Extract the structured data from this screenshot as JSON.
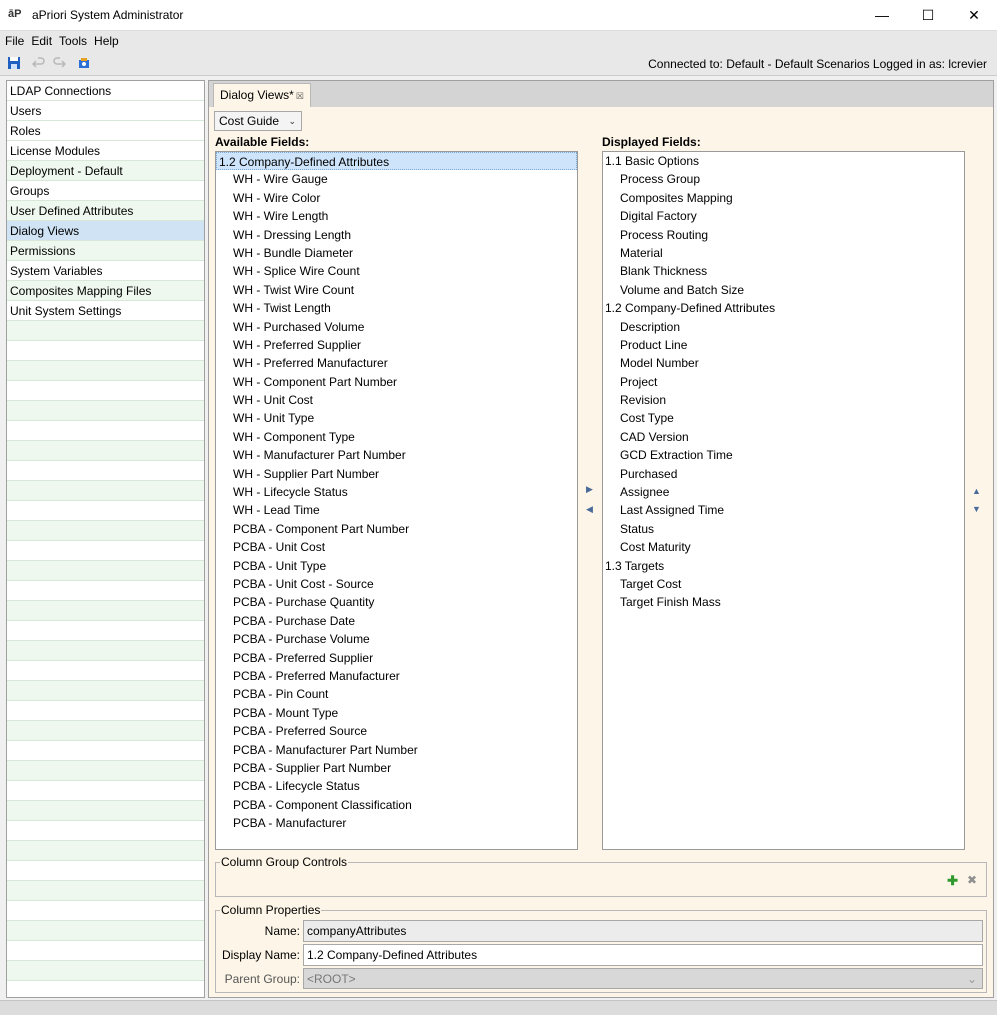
{
  "window": {
    "logo": "āP",
    "title": "aPriori System Administrator",
    "minimize": "—",
    "maximize": "☐",
    "close": "✕"
  },
  "menu": [
    "File",
    "Edit",
    "Tools",
    "Help"
  ],
  "toolbar": {
    "status": "Connected to: Default - Default Scenarios  Logged in as: lcrevier"
  },
  "sidebar": {
    "items": [
      {
        "label": "LDAP Connections"
      },
      {
        "label": "Users"
      },
      {
        "label": "Roles"
      },
      {
        "label": "License Modules"
      },
      {
        "label": "Deployment - Default"
      },
      {
        "label": "Groups"
      },
      {
        "label": "User Defined Attributes"
      },
      {
        "label": "Dialog Views",
        "selected": true
      },
      {
        "label": "Permissions"
      },
      {
        "label": "System Variables"
      },
      {
        "label": "Composites Mapping Files"
      },
      {
        "label": "Unit System Settings"
      }
    ]
  },
  "editor": {
    "tab_label": "Dialog Views*",
    "tab_close": "☒",
    "view_select": "Cost Guide",
    "available_label": "Available Fields:",
    "displayed_label": "Displayed Fields:",
    "available_fields": [
      {
        "label": "1.2 Company-Defined Attributes",
        "level": 0,
        "selected": true
      },
      {
        "label": "WH - Wire Gauge",
        "level": 1
      },
      {
        "label": "WH - Wire Color",
        "level": 1
      },
      {
        "label": "WH - Wire Length",
        "level": 1
      },
      {
        "label": "WH - Dressing Length",
        "level": 1
      },
      {
        "label": "WH - Bundle Diameter",
        "level": 1
      },
      {
        "label": "WH - Splice Wire Count",
        "level": 1
      },
      {
        "label": "WH - Twist Wire Count",
        "level": 1
      },
      {
        "label": "WH - Twist Length",
        "level": 1
      },
      {
        "label": "WH - Purchased Volume",
        "level": 1
      },
      {
        "label": "WH - Preferred Supplier",
        "level": 1
      },
      {
        "label": "WH - Preferred Manufacturer",
        "level": 1
      },
      {
        "label": "WH - Component Part Number",
        "level": 1
      },
      {
        "label": "WH - Unit Cost",
        "level": 1
      },
      {
        "label": "WH - Unit Type",
        "level": 1
      },
      {
        "label": "WH - Component Type",
        "level": 1
      },
      {
        "label": "WH - Manufacturer Part Number",
        "level": 1
      },
      {
        "label": "WH - Supplier Part Number",
        "level": 1
      },
      {
        "label": "WH - Lifecycle Status",
        "level": 1
      },
      {
        "label": "WH - Lead Time",
        "level": 1
      },
      {
        "label": "PCBA - Component Part Number",
        "level": 1
      },
      {
        "label": "PCBA - Unit Cost",
        "level": 1
      },
      {
        "label": "PCBA - Unit Type",
        "level": 1
      },
      {
        "label": "PCBA - Unit Cost - Source",
        "level": 1
      },
      {
        "label": "PCBA - Purchase Quantity",
        "level": 1
      },
      {
        "label": "PCBA - Purchase Date",
        "level": 1
      },
      {
        "label": "PCBA - Purchase Volume",
        "level": 1
      },
      {
        "label": "PCBA - Preferred Supplier",
        "level": 1
      },
      {
        "label": "PCBA - Preferred Manufacturer",
        "level": 1
      },
      {
        "label": "PCBA - Pin Count",
        "level": 1
      },
      {
        "label": "PCBA - Mount Type",
        "level": 1
      },
      {
        "label": "PCBA - Preferred Source",
        "level": 1
      },
      {
        "label": "PCBA - Manufacturer Part Number",
        "level": 1
      },
      {
        "label": "PCBA - Supplier Part Number",
        "level": 1
      },
      {
        "label": "PCBA - Lifecycle Status",
        "level": 1
      },
      {
        "label": "PCBA - Component Classification",
        "level": 1
      },
      {
        "label": "PCBA - Manufacturer",
        "level": 1
      }
    ],
    "displayed_fields": [
      {
        "label": "1.1 Basic Options",
        "level": 0
      },
      {
        "label": "Process Group",
        "level": 1
      },
      {
        "label": "Composites Mapping",
        "level": 1
      },
      {
        "label": "Digital Factory",
        "level": 1
      },
      {
        "label": "Process Routing",
        "level": 1
      },
      {
        "label": "Material",
        "level": 1
      },
      {
        "label": "Blank Thickness",
        "level": 1
      },
      {
        "label": "Volume and Batch Size",
        "level": 1
      },
      {
        "label": "1.2 Company-Defined Attributes",
        "level": 0
      },
      {
        "label": "Description",
        "level": 1
      },
      {
        "label": "Product Line",
        "level": 1
      },
      {
        "label": "Model Number",
        "level": 1
      },
      {
        "label": "Project",
        "level": 1
      },
      {
        "label": "Revision",
        "level": 1
      },
      {
        "label": "Cost Type",
        "level": 1
      },
      {
        "label": "CAD Version",
        "level": 1
      },
      {
        "label": "GCD Extraction Time",
        "level": 1
      },
      {
        "label": "Purchased",
        "level": 1
      },
      {
        "label": "Assignee",
        "level": 1
      },
      {
        "label": "Last Assigned Time",
        "level": 1
      },
      {
        "label": "Status",
        "level": 1
      },
      {
        "label": "Cost Maturity",
        "level": 1
      },
      {
        "label": "1.3 Targets",
        "level": 0
      },
      {
        "label": "Target Cost",
        "level": 1
      },
      {
        "label": "Target Finish Mass",
        "level": 1
      }
    ],
    "move_right": "▶",
    "move_left": "◀",
    "move_up": "▲",
    "move_down": "▼",
    "column_group_title": "Column Group Controls",
    "add_glyph": "✚",
    "remove_glyph": "✖",
    "column_props_title": "Column Properties",
    "name_label": "Name:",
    "name_value": "companyAttributes",
    "display_name_label": "Display Name:",
    "display_name_value": "1.2 Company-Defined Attributes",
    "parent_group_label": "Parent Group:",
    "parent_group_value": "<ROOT>",
    "dropdown_glyph": "⌄"
  },
  "colors": {
    "content_bg": "#fdf6e8",
    "selection": "#cfe3f5",
    "sidebar_alt": "#eef8ee",
    "add_green": "#2e9a2e"
  }
}
